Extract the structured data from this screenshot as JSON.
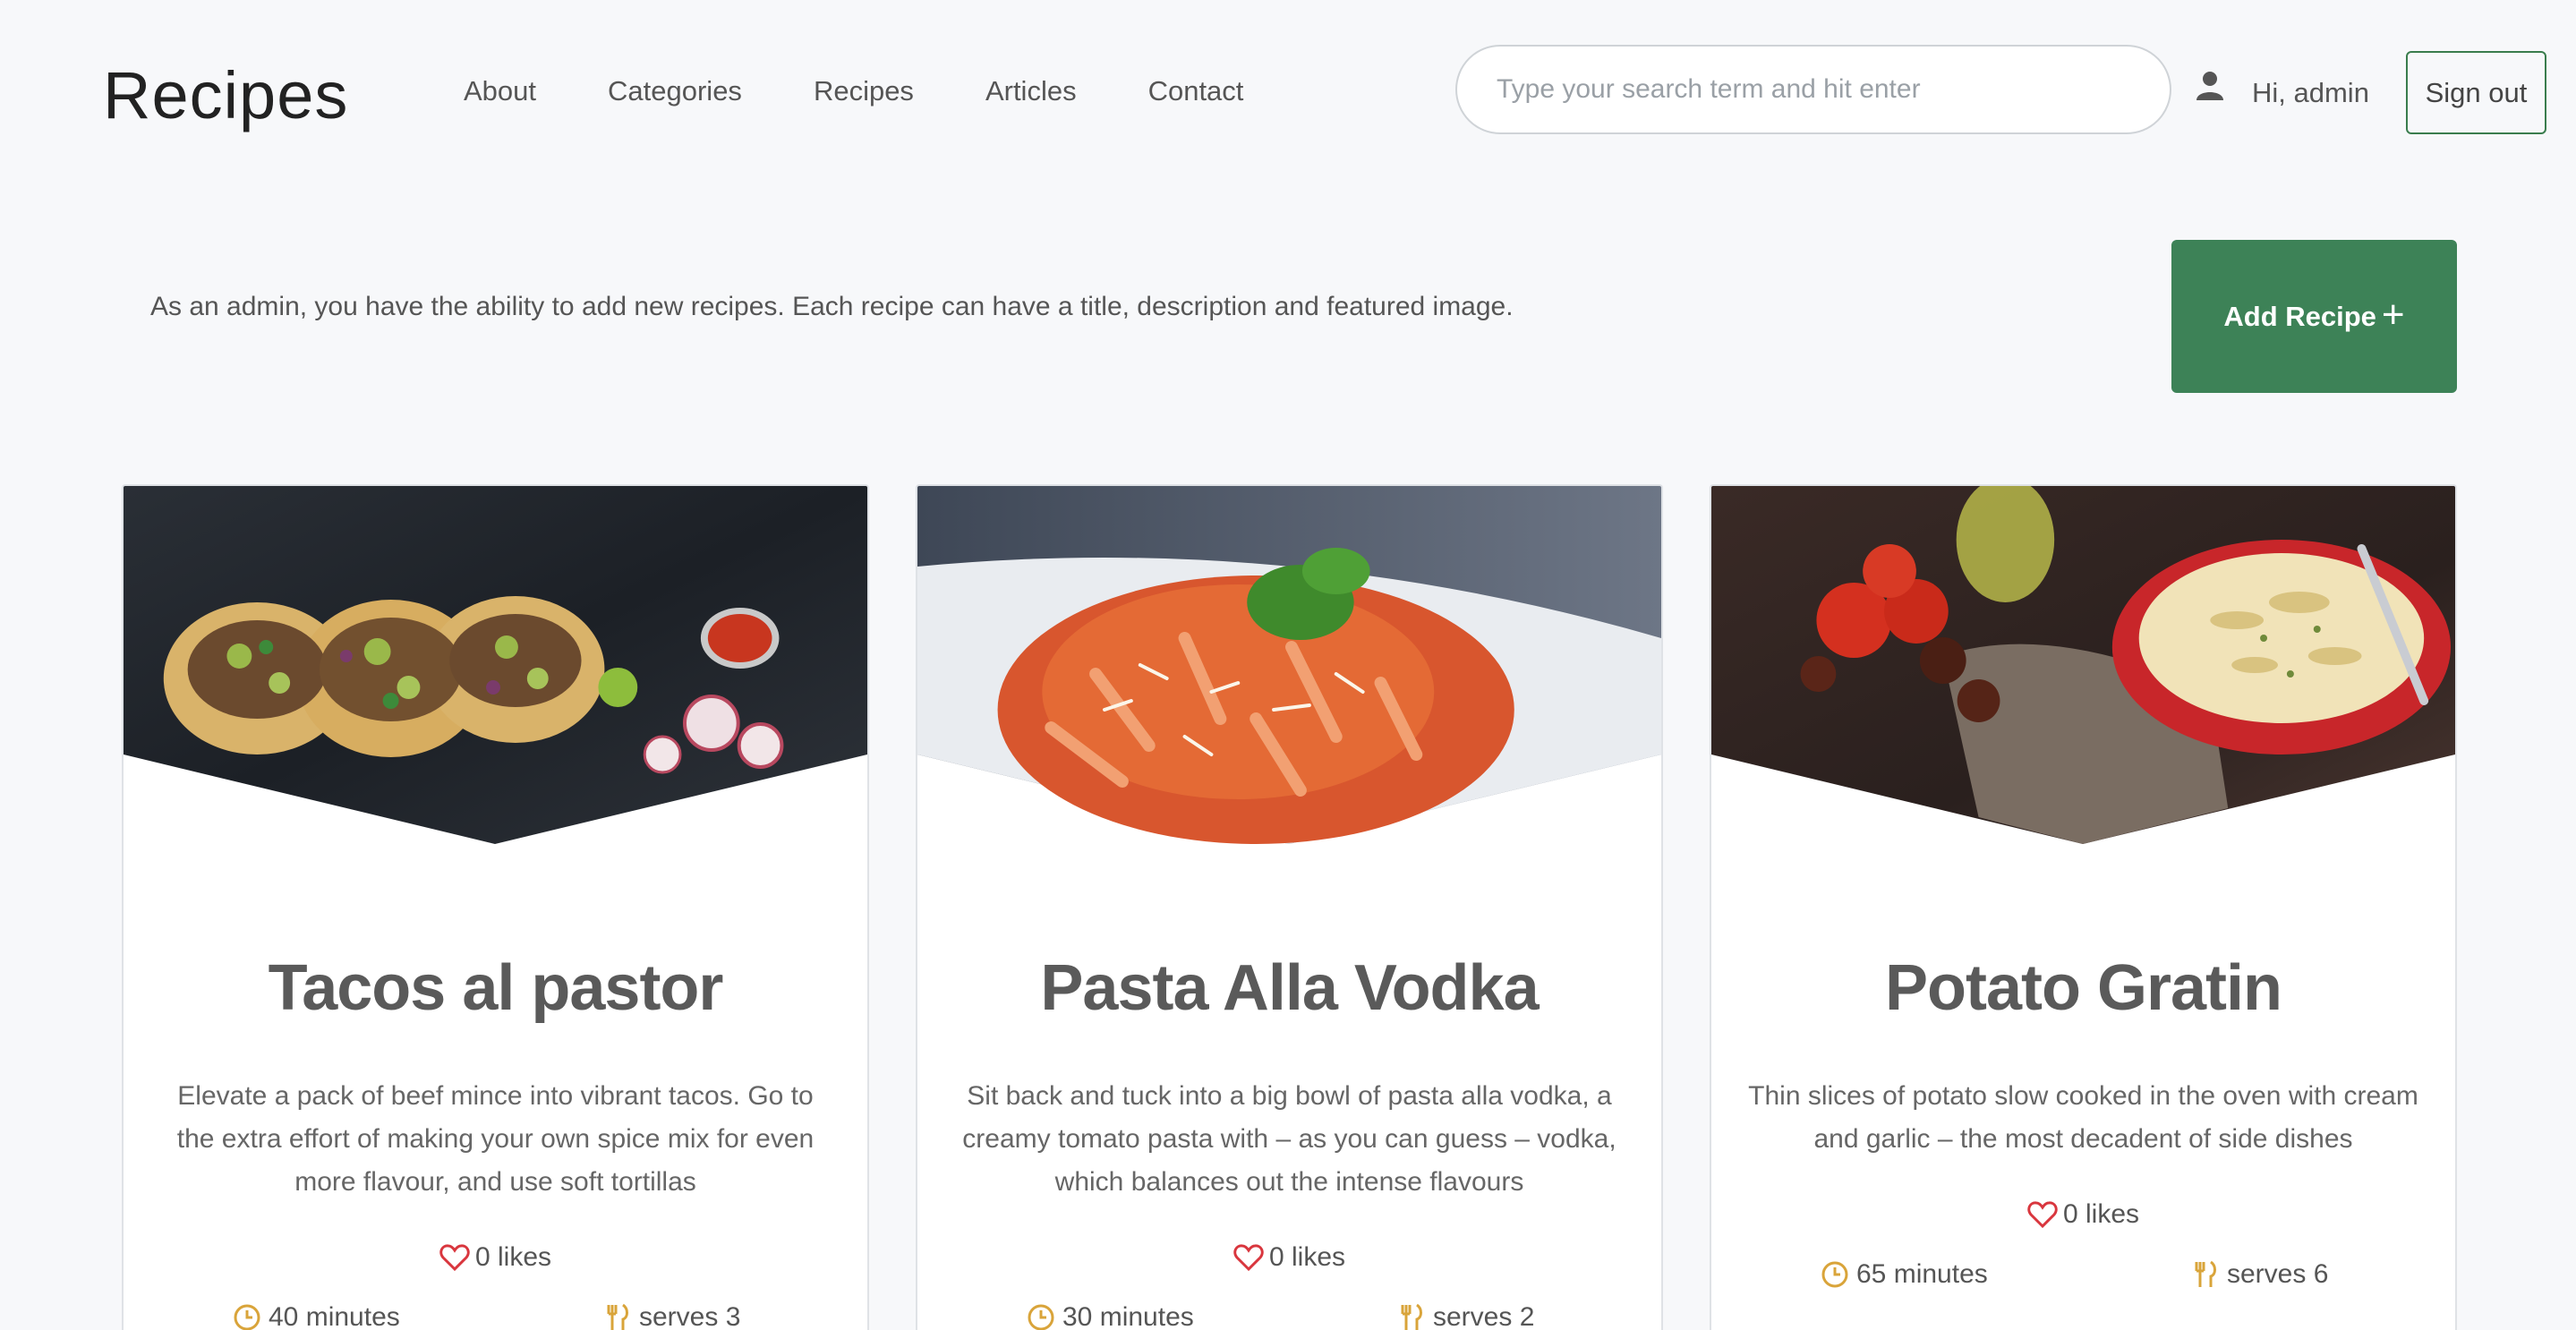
{
  "header": {
    "brand": "Recipes",
    "nav": [
      "About",
      "Categories",
      "Recipes",
      "Articles",
      "Contact"
    ],
    "search_placeholder": "Type your search term and hit enter",
    "greeting": "Hi, admin",
    "signout_label": "Sign out"
  },
  "admin": {
    "notice": "As an admin, you have the ability to add new recipes. Each recipe can have a title, description and featured image.",
    "add_label": "Add Recipe"
  },
  "colors": {
    "accent_green": "#3d8257",
    "heart_red": "#d9363e",
    "meta_gold": "#d9a43a"
  },
  "recipes": [
    {
      "title": "Tacos al pastor",
      "description": "Elevate a pack of beef mince into vibrant tacos. Go to the extra effort of making your own spice mix for even more flavour, and use soft tortillas",
      "likes": "0 likes",
      "time": "40 minutes",
      "serves": "serves 3",
      "image": "tacos-photo"
    },
    {
      "title": "Pasta Alla Vodka",
      "description": "Sit back and tuck into a big bowl of pasta alla vodka, a creamy tomato pasta with – as you can guess – vodka, which balances out the intense flavours",
      "likes": "0 likes",
      "time": "30 minutes",
      "serves": "serves 2",
      "image": "pasta-photo"
    },
    {
      "title": "Potato Gratin",
      "description": "Thin slices of potato slow cooked in the oven with cream and garlic – the most decadent of side dishes",
      "likes": "0 likes",
      "time": "65 minutes",
      "serves": "serves 6",
      "image": "gratin-photo"
    }
  ]
}
